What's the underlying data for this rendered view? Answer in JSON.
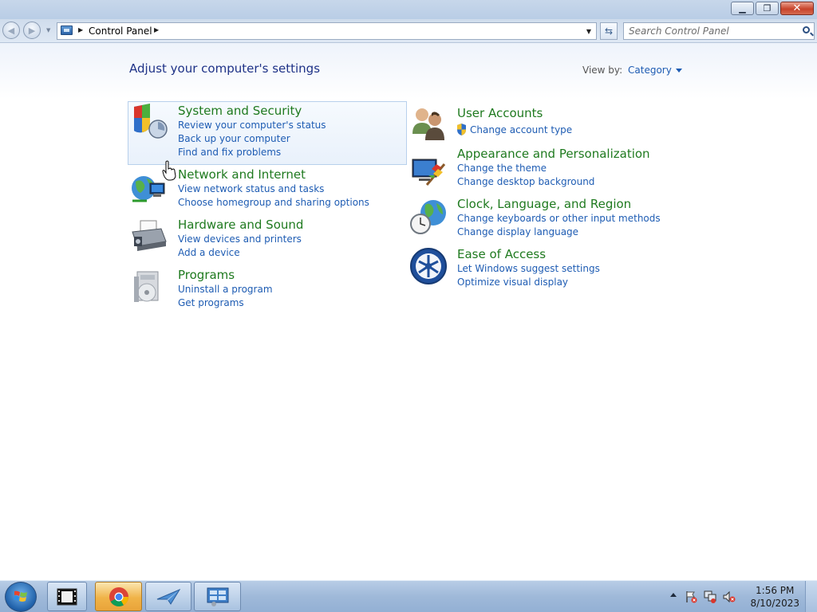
{
  "window": {
    "controls": [
      "minimize-icon",
      "restore-icon",
      "close-icon"
    ]
  },
  "nav": {
    "address_crumb": "Control Panel",
    "search_placeholder": "Search Control Panel"
  },
  "main": {
    "heading": "Adjust your computer's settings",
    "view_by_label": "View by:",
    "view_by_value": "Category",
    "left_categories": [
      {
        "title": "System and Security",
        "links": [
          "Review your computer's status",
          "Back up your computer",
          "Find and fix problems"
        ]
      },
      {
        "title": "Network and Internet",
        "links": [
          "View network status and tasks",
          "Choose homegroup and sharing options"
        ]
      },
      {
        "title": "Hardware and Sound",
        "links": [
          "View devices and printers",
          "Add a device"
        ]
      },
      {
        "title": "Programs",
        "links": [
          "Uninstall a program",
          "Get programs"
        ]
      }
    ],
    "right_categories": [
      {
        "title": "User Accounts",
        "links": [
          "Change account type"
        ]
      },
      {
        "title": "Appearance and Personalization",
        "links": [
          "Change the theme",
          "Change desktop background"
        ]
      },
      {
        "title": "Clock, Language, and Region",
        "links": [
          "Change keyboards or other input methods",
          "Change display language"
        ]
      },
      {
        "title": "Ease of Access",
        "links": [
          "Let Windows suggest settings",
          "Optimize visual display"
        ]
      }
    ]
  },
  "taskbar": {
    "time": "1:56 PM",
    "date": "8/10/2023",
    "pinned": [
      "media-center-icon",
      "chrome-icon",
      "paper-plane-icon",
      "control-panel-icon"
    ]
  },
  "colors": {
    "category_title": "#1f7a1f",
    "link": "#1e5cb3",
    "heading": "#1e3287"
  }
}
